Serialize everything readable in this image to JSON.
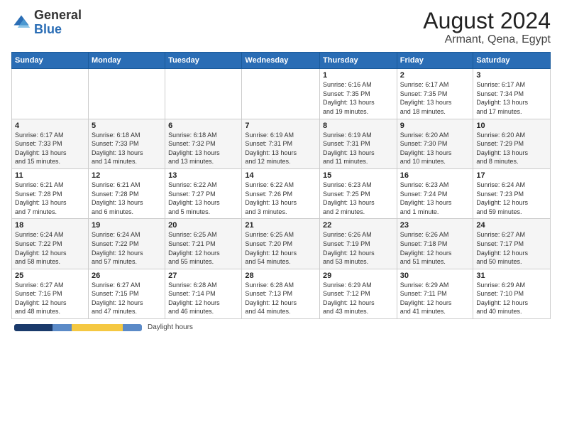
{
  "header": {
    "logo_general": "General",
    "logo_blue": "Blue",
    "title": "August 2024",
    "subtitle": "Armant, Qena, Egypt"
  },
  "days_of_week": [
    "Sunday",
    "Monday",
    "Tuesday",
    "Wednesday",
    "Thursday",
    "Friday",
    "Saturday"
  ],
  "weeks": [
    [
      {
        "day": "",
        "info": ""
      },
      {
        "day": "",
        "info": ""
      },
      {
        "day": "",
        "info": ""
      },
      {
        "day": "",
        "info": ""
      },
      {
        "day": "1",
        "info": "Sunrise: 6:16 AM\nSunset: 7:35 PM\nDaylight: 13 hours\nand 19 minutes."
      },
      {
        "day": "2",
        "info": "Sunrise: 6:17 AM\nSunset: 7:35 PM\nDaylight: 13 hours\nand 18 minutes."
      },
      {
        "day": "3",
        "info": "Sunrise: 6:17 AM\nSunset: 7:34 PM\nDaylight: 13 hours\nand 17 minutes."
      }
    ],
    [
      {
        "day": "4",
        "info": "Sunrise: 6:17 AM\nSunset: 7:33 PM\nDaylight: 13 hours\nand 15 minutes."
      },
      {
        "day": "5",
        "info": "Sunrise: 6:18 AM\nSunset: 7:33 PM\nDaylight: 13 hours\nand 14 minutes."
      },
      {
        "day": "6",
        "info": "Sunrise: 6:18 AM\nSunset: 7:32 PM\nDaylight: 13 hours\nand 13 minutes."
      },
      {
        "day": "7",
        "info": "Sunrise: 6:19 AM\nSunset: 7:31 PM\nDaylight: 13 hours\nand 12 minutes."
      },
      {
        "day": "8",
        "info": "Sunrise: 6:19 AM\nSunset: 7:31 PM\nDaylight: 13 hours\nand 11 minutes."
      },
      {
        "day": "9",
        "info": "Sunrise: 6:20 AM\nSunset: 7:30 PM\nDaylight: 13 hours\nand 10 minutes."
      },
      {
        "day": "10",
        "info": "Sunrise: 6:20 AM\nSunset: 7:29 PM\nDaylight: 13 hours\nand 8 minutes."
      }
    ],
    [
      {
        "day": "11",
        "info": "Sunrise: 6:21 AM\nSunset: 7:28 PM\nDaylight: 13 hours\nand 7 minutes."
      },
      {
        "day": "12",
        "info": "Sunrise: 6:21 AM\nSunset: 7:28 PM\nDaylight: 13 hours\nand 6 minutes."
      },
      {
        "day": "13",
        "info": "Sunrise: 6:22 AM\nSunset: 7:27 PM\nDaylight: 13 hours\nand 5 minutes."
      },
      {
        "day": "14",
        "info": "Sunrise: 6:22 AM\nSunset: 7:26 PM\nDaylight: 13 hours\nand 3 minutes."
      },
      {
        "day": "15",
        "info": "Sunrise: 6:23 AM\nSunset: 7:25 PM\nDaylight: 13 hours\nand 2 minutes."
      },
      {
        "day": "16",
        "info": "Sunrise: 6:23 AM\nSunset: 7:24 PM\nDaylight: 13 hours\nand 1 minute."
      },
      {
        "day": "17",
        "info": "Sunrise: 6:24 AM\nSunset: 7:23 PM\nDaylight: 12 hours\nand 59 minutes."
      }
    ],
    [
      {
        "day": "18",
        "info": "Sunrise: 6:24 AM\nSunset: 7:22 PM\nDaylight: 12 hours\nand 58 minutes."
      },
      {
        "day": "19",
        "info": "Sunrise: 6:24 AM\nSunset: 7:22 PM\nDaylight: 12 hours\nand 57 minutes."
      },
      {
        "day": "20",
        "info": "Sunrise: 6:25 AM\nSunset: 7:21 PM\nDaylight: 12 hours\nand 55 minutes."
      },
      {
        "day": "21",
        "info": "Sunrise: 6:25 AM\nSunset: 7:20 PM\nDaylight: 12 hours\nand 54 minutes."
      },
      {
        "day": "22",
        "info": "Sunrise: 6:26 AM\nSunset: 7:19 PM\nDaylight: 12 hours\nand 53 minutes."
      },
      {
        "day": "23",
        "info": "Sunrise: 6:26 AM\nSunset: 7:18 PM\nDaylight: 12 hours\nand 51 minutes."
      },
      {
        "day": "24",
        "info": "Sunrise: 6:27 AM\nSunset: 7:17 PM\nDaylight: 12 hours\nand 50 minutes."
      }
    ],
    [
      {
        "day": "25",
        "info": "Sunrise: 6:27 AM\nSunset: 7:16 PM\nDaylight: 12 hours\nand 48 minutes."
      },
      {
        "day": "26",
        "info": "Sunrise: 6:27 AM\nSunset: 7:15 PM\nDaylight: 12 hours\nand 47 minutes."
      },
      {
        "day": "27",
        "info": "Sunrise: 6:28 AM\nSunset: 7:14 PM\nDaylight: 12 hours\nand 46 minutes."
      },
      {
        "day": "28",
        "info": "Sunrise: 6:28 AM\nSunset: 7:13 PM\nDaylight: 12 hours\nand 44 minutes."
      },
      {
        "day": "29",
        "info": "Sunrise: 6:29 AM\nSunset: 7:12 PM\nDaylight: 12 hours\nand 43 minutes."
      },
      {
        "day": "30",
        "info": "Sunrise: 6:29 AM\nSunset: 7:11 PM\nDaylight: 12 hours\nand 41 minutes."
      },
      {
        "day": "31",
        "info": "Sunrise: 6:29 AM\nSunset: 7:10 PM\nDaylight: 12 hours\nand 40 minutes."
      }
    ]
  ],
  "footer": {
    "daylight_label": "Daylight hours",
    "bar_colors": {
      "night": "#1a3a6b",
      "twilight": "#5b8ac7",
      "daylight": "#f5c842"
    }
  }
}
